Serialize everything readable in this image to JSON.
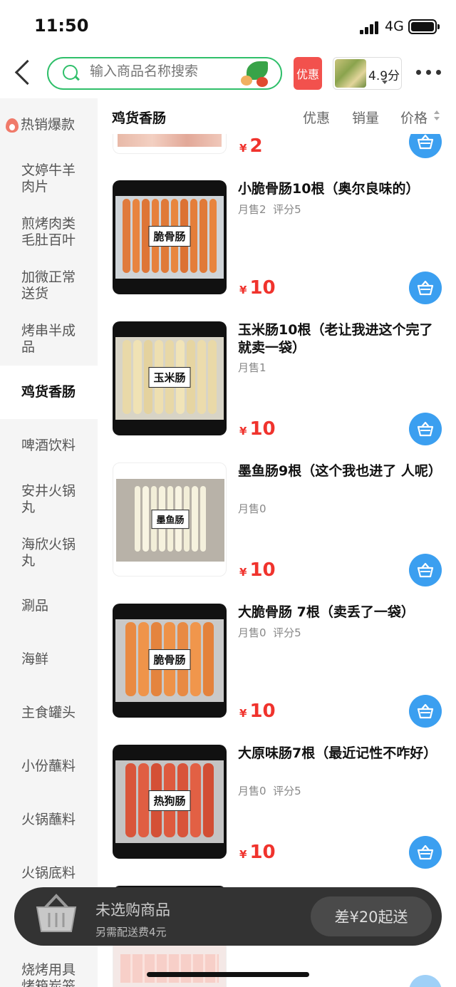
{
  "status_bar": {
    "time": "11:50",
    "network": "4G"
  },
  "nav": {
    "search_placeholder": "输入商品名称搜索",
    "promo_label": "优惠",
    "rating": "4.9分"
  },
  "sidebar": {
    "categories": [
      {
        "label": "热销爆款"
      },
      {
        "label": "文婷牛羊肉片"
      },
      {
        "label": "煎烤肉类毛肚百叶"
      },
      {
        "label": "加微正常送货"
      },
      {
        "label": "烤串半成品"
      },
      {
        "label": "鸡货香肠"
      },
      {
        "label": "啤酒饮料"
      },
      {
        "label": "安井火锅丸"
      },
      {
        "label": "海欣火锅丸"
      },
      {
        "label": "涮品"
      },
      {
        "label": "海鲜"
      },
      {
        "label": "主食罐头"
      },
      {
        "label": "小份蘸料"
      },
      {
        "label": "火锅蘸料"
      },
      {
        "label": "火锅底料"
      },
      {
        "label": "烧烤用具烤箱炭笼"
      }
    ],
    "active_index": 5
  },
  "list_header": {
    "title": "鸡货香肠",
    "sort_promo": "优惠",
    "sort_sales": "销量",
    "sort_price": "价格"
  },
  "currency": "¥",
  "partial_top": {
    "price": "2"
  },
  "products": [
    {
      "title": "小脆骨肠10根（奥尔良味的）",
      "sales": "月售2",
      "score": "评分5",
      "price": "10",
      "package_label": "脆骨肠"
    },
    {
      "title": "玉米肠10根（老让我进这个完了就卖一袋）",
      "sales": "月售1",
      "score": "",
      "price": "10",
      "package_label": "玉米肠"
    },
    {
      "title": "墨鱼肠9根（这个我也进了 人呢）",
      "sales": "月售0",
      "score": "",
      "price": "10",
      "package_label": "墨鱼肠"
    },
    {
      "title": "大脆骨肠 7根（卖丢了一袋）",
      "sales": "月售0",
      "score": "评分5",
      "price": "10",
      "package_label": "脆骨肠"
    },
    {
      "title": "大原味肠7根（最近记性不咋好）",
      "sales": "月售0",
      "score": "评分5",
      "price": "10",
      "package_label": "热狗肠"
    }
  ],
  "cart_bar": {
    "title": "未选购商品",
    "delivery_fee": "另需配送费4元",
    "checkout": "差¥20起送"
  },
  "colors": {
    "accent_green": "#2fbf6a",
    "price_red": "#f0332d",
    "cart_blue": "#3b9ff0",
    "promo_red": "#f2514d"
  }
}
